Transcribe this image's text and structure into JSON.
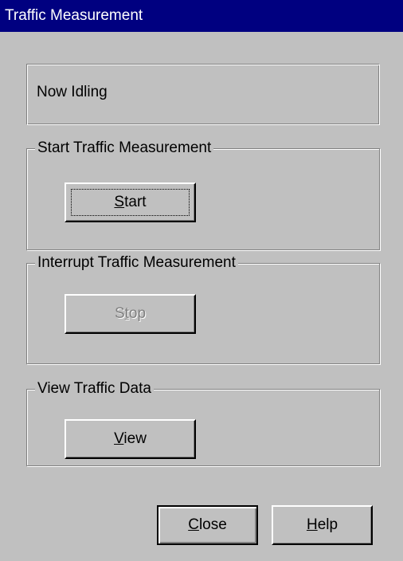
{
  "window": {
    "title": "Traffic Measurement"
  },
  "status": {
    "text": "Now Idling"
  },
  "start_group": {
    "label": "Start Traffic Measurement",
    "button": {
      "accel": "S",
      "rest": "tart",
      "enabled": true,
      "focused": true
    }
  },
  "stop_group": {
    "label": "Interrupt Traffic Measurement",
    "button": {
      "pre": "S",
      "accel": "t",
      "rest": "op",
      "enabled": false
    }
  },
  "view_group": {
    "label": "View Traffic Data",
    "button": {
      "accel": "V",
      "rest": "iew",
      "enabled": true
    }
  },
  "footer": {
    "close": {
      "accel": "C",
      "rest": "lose"
    },
    "help": {
      "accel": "H",
      "rest": "elp"
    }
  },
  "colors": {
    "title_bar": "#000080",
    "face": "#c0c0c0",
    "disabled_text": "#808080"
  }
}
